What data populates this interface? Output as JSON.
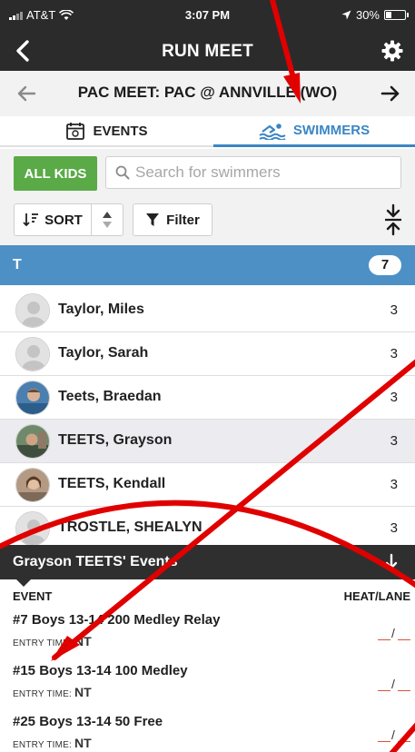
{
  "status_bar": {
    "carrier": "AT&T",
    "time": "3:07 PM",
    "battery_percent_label": "30%",
    "battery_level": 0.3
  },
  "nav": {
    "title": "RUN MEET",
    "back_icon": "chevron-left-icon",
    "settings_icon": "gear-icon"
  },
  "meet": {
    "title": "PAC MEET:  PAC @ ANNVILLE (WO)",
    "prev_icon": "arrow-left-icon",
    "next_icon": "arrow-right-icon"
  },
  "tabs": [
    {
      "label": "EVENTS",
      "icon": "calendar-icon",
      "active": false
    },
    {
      "label": "SWIMMERS",
      "icon": "swimmer-icon",
      "active": true
    }
  ],
  "filters": {
    "all_kids_label": "ALL KIDS",
    "search_placeholder": "Search for swimmers",
    "sort_label": "SORT",
    "filter_label": "Filter"
  },
  "group": {
    "letter": "T",
    "count": "7"
  },
  "swimmers": [
    {
      "name": "Taylor, Miles",
      "count": "3",
      "avatar": "placeholder",
      "selected": false
    },
    {
      "name": "Taylor, Sarah",
      "count": "3",
      "avatar": "placeholder",
      "selected": false
    },
    {
      "name": "Teets, Braedan",
      "count": "3",
      "avatar": "photo",
      "selected": false
    },
    {
      "name": "TEETS, Grayson",
      "count": "3",
      "avatar": "photo",
      "selected": true
    },
    {
      "name": "TEETS, Kendall",
      "count": "3",
      "avatar": "photo",
      "selected": false
    },
    {
      "name": "TROSTLE, SHEALYN",
      "count": "3",
      "avatar": "placeholder",
      "selected": false
    }
  ],
  "events_panel": {
    "title": "Grayson TEETS' Events",
    "col_event": "EVENT",
    "col_heat_lane": "HEAT/LANE",
    "entry_time_label": "ENTRY TIME:",
    "heat_lane_separator": "/",
    "events": [
      {
        "name": "#7 Boys 13-14 200 Medley Relay",
        "entry_time": "NT"
      },
      {
        "name": "#15 Boys 13-14 100 Medley",
        "entry_time": "NT"
      },
      {
        "name": "#25 Boys 13-14 50 Free",
        "entry_time": "NT"
      }
    ]
  },
  "colors": {
    "nav_bg": "#2b2b2b",
    "accent_blue": "#3a86c5",
    "group_header_bg": "#4d90c6",
    "all_kids_green": "#5aaa47",
    "annotation_red": "#e00000"
  }
}
